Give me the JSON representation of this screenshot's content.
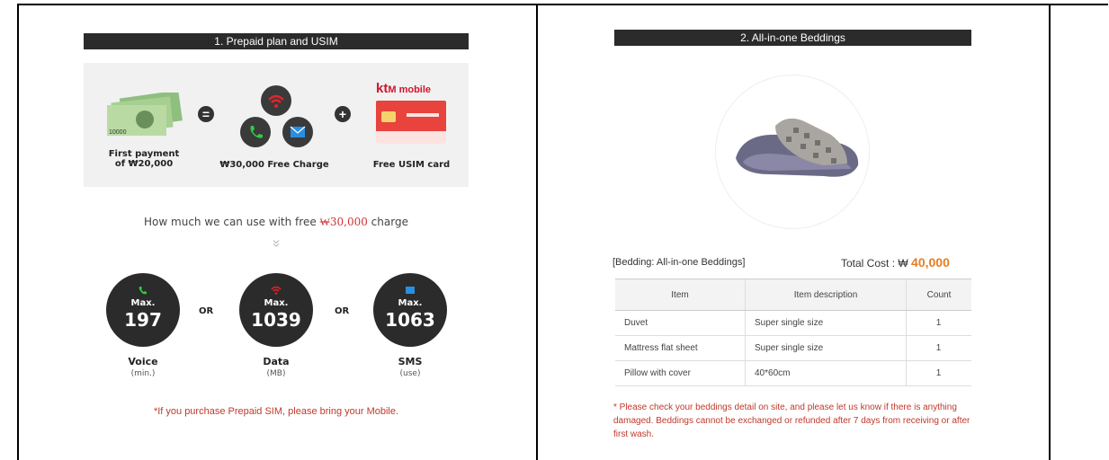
{
  "section1": {
    "header": "1. Prepaid plan and USIM",
    "promo": {
      "banknote_number": "10000",
      "payment_line1": "First payment",
      "payment_line2": "of ₩20,000",
      "equals": "=",
      "plus": "+",
      "charge_caption": "₩30,000 Free Charge",
      "brand_kt": "kt",
      "brand_mobile": "M mobile",
      "usim_caption": "Free USIM card"
    },
    "howmuch_before": "How much we can use with free ",
    "howmuch_amount": "₩30,000",
    "howmuch_after": " charge",
    "chevron": "»",
    "usage": [
      {
        "max": "Max.",
        "value": "197",
        "label": "Voice",
        "unit": "(min.)",
        "icon": "phone-icon",
        "color": "#2ecc40"
      },
      {
        "max": "Max.",
        "value": "1039",
        "label": "Data",
        "unit": "(MB)",
        "icon": "wifi-icon",
        "color": "#e0242a"
      },
      {
        "max": "Max.",
        "value": "1063",
        "label": "SMS",
        "unit": "(use)",
        "icon": "mail-icon",
        "color": "#2a8ee0"
      }
    ],
    "or": "OR",
    "note": "*If you purchase Prepaid SIM, please bring your Mobile."
  },
  "section2": {
    "header": "2. All-in-one Beddings",
    "bedding_label": "[Bedding: All-in-one Beddings]",
    "total_label": "Total Cost : ₩",
    "total_value": "40,000",
    "table": {
      "headers": [
        "Item",
        "Item description",
        "Count"
      ],
      "rows": [
        [
          "Duvet",
          "Super single size",
          "1"
        ],
        [
          "Mattress flat sheet",
          "Super single size",
          "1"
        ],
        [
          "Pillow with cover",
          "40*60cm",
          "1"
        ]
      ]
    },
    "note": "* Please check your beddings detail on site, and please let us know if there is anything damaged. Beddings cannot be exchanged or refunded after 7 days from receiving or after first wash."
  },
  "colors": {
    "header_bg": "#2b2b2b",
    "accent_red": "#d23131",
    "price_orange": "#e67e22"
  }
}
